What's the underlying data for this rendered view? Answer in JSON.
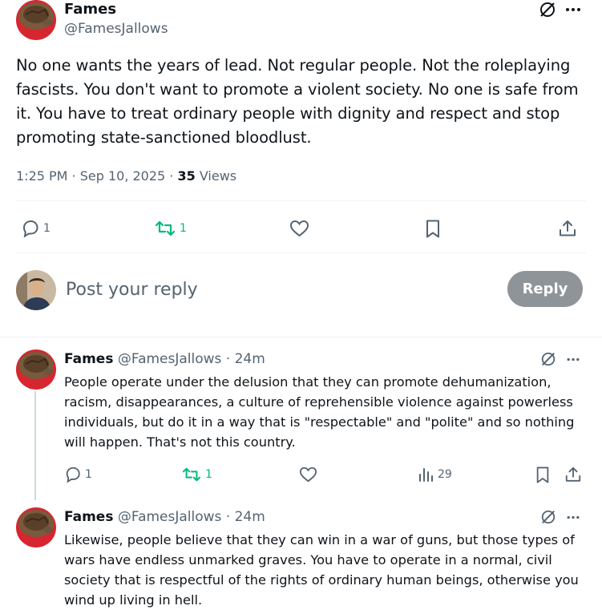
{
  "main_post": {
    "display_name": "Fames",
    "handle": "@FamesJallows",
    "text": "No one wants the years of lead. Not regular people. Not the roleplaying fascists. You don't want to promote a violent society. No one is safe from it. You have to treat ordinary people with dignity and respect and stop promoting state-sanctioned bloodlust.",
    "timestamp": "1:25 PM · Sep 10, 2025 · ",
    "views_count": "35",
    "views_label": " Views",
    "reply_count": "1",
    "repost_count": "1"
  },
  "composer": {
    "placeholder": "Post your reply",
    "reply_button": "Reply"
  },
  "replies": [
    {
      "display_name": "Fames",
      "handle_time": "@FamesJallows · 24m",
      "text": "People operate under the delusion that they can promote dehumanization, racism, disappearances, a culture of reprehensible violence against powerless individuals, but do it in a way that is \"respectable\" and \"polite\" and so nothing will happen. That's not this country.",
      "reply_count": "1",
      "repost_count": "1",
      "views_count": "29"
    },
    {
      "display_name": "Fames",
      "handle_time": "@FamesJallows · 24m",
      "text": "Likewise, people believe that they can win in a war of guns, but those types of wars have endless unmarked graves. You have to operate in a normal, civil society that is respectful of the rights of ordinary human beings, otherwise you wind up living in hell."
    }
  ],
  "colors": {
    "repost_green": "#00ba7c",
    "secondary_text": "#536471",
    "reply_button_bg": "#8f9498",
    "thread_line": "#cfd9de"
  }
}
